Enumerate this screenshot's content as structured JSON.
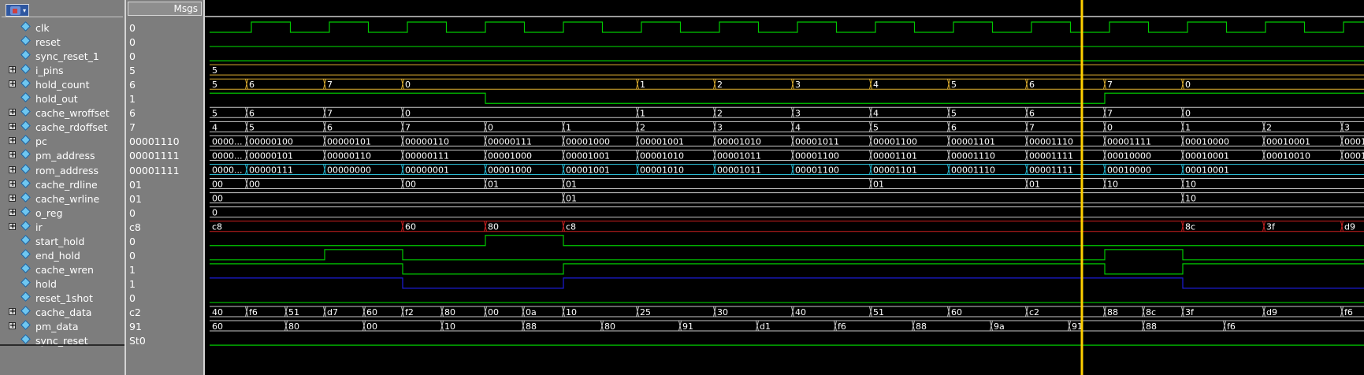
{
  "toolbar": {
    "icon": "wave-tool-icon",
    "dropdown": "▾"
  },
  "values_header": "Msgs",
  "colors": {
    "bit": "#00c800",
    "bus": "#c8c8c8",
    "yellow": "#e0b030",
    "cyan": "#2ab8d0",
    "red": "#d02020",
    "blue": "#1c1cd8",
    "cursor": "#ffd000"
  },
  "signals": [
    {
      "name": "clk",
      "value": "0",
      "expandable": false
    },
    {
      "name": "reset",
      "value": "0",
      "expandable": false
    },
    {
      "name": "sync_reset_1",
      "value": "0",
      "expandable": false
    },
    {
      "name": "i_pins",
      "value": "5",
      "expandable": true
    },
    {
      "name": "hold_count",
      "value": "6",
      "expandable": true
    },
    {
      "name": "hold_out",
      "value": "1",
      "expandable": false
    },
    {
      "name": "cache_wroffset",
      "value": "6",
      "expandable": true
    },
    {
      "name": "cache_rdoffset",
      "value": "7",
      "expandable": true
    },
    {
      "name": "pc",
      "value": "00001110",
      "expandable": true
    },
    {
      "name": "pm_address",
      "value": "00001111",
      "expandable": true
    },
    {
      "name": "rom_address",
      "value": "00001111",
      "expandable": true
    },
    {
      "name": "cache_rdline",
      "value": "01",
      "expandable": true
    },
    {
      "name": "cache_wrline",
      "value": "01",
      "expandable": true
    },
    {
      "name": "o_reg",
      "value": "0",
      "expandable": true
    },
    {
      "name": "ir",
      "value": "c8",
      "expandable": true
    },
    {
      "name": "start_hold",
      "value": "0",
      "expandable": false
    },
    {
      "name": "end_hold",
      "value": "0",
      "expandable": false
    },
    {
      "name": "cache_wren",
      "value": "1",
      "expandable": false
    },
    {
      "name": "hold",
      "value": "1",
      "expandable": false
    },
    {
      "name": "reset_1shot",
      "value": "0",
      "expandable": false
    },
    {
      "name": "cache_data",
      "value": "c2",
      "expandable": true
    },
    {
      "name": "pm_data",
      "value": "91",
      "expandable": true
    },
    {
      "name": "sync_reset",
      "value": "St0",
      "expandable": false
    }
  ],
  "waves": {
    "clk": {
      "type": "clock",
      "color": "bit",
      "initial": 0,
      "period": 99,
      "start": 53,
      "high_first": true
    },
    "reset": {
      "type": "level",
      "color": "bit",
      "level": 0
    },
    "sync_reset_1": {
      "type": "level",
      "color": "bit",
      "level": 0
    },
    "i_pins": {
      "type": "bus",
      "color": "yellow",
      "segments": [
        [
          "5",
          0
        ]
      ]
    },
    "hold_count": {
      "type": "bus",
      "color": "yellow",
      "segments": [
        [
          "5",
          0
        ],
        [
          "6",
          47
        ],
        [
          "7",
          146
        ],
        [
          "0",
          245
        ],
        [
          "1",
          543
        ],
        [
          "2",
          641
        ],
        [
          "3",
          740
        ],
        [
          "4",
          839
        ],
        [
          "5",
          938
        ],
        [
          "6",
          1037
        ],
        [
          "7",
          1136
        ],
        [
          "0",
          1235
        ]
      ]
    },
    "hold_out": {
      "type": "edges",
      "color": "bit",
      "initial": 1,
      "edges": [
        [
          0,
          1
        ],
        [
          350,
          0
        ],
        [
          1136,
          1
        ]
      ]
    },
    "cache_wroffset": {
      "type": "bus",
      "color": "bus",
      "segments": [
        [
          "5",
          0
        ],
        [
          "6",
          47
        ],
        [
          "7",
          146
        ],
        [
          "0",
          245
        ],
        [
          "1",
          543
        ],
        [
          "2",
          641
        ],
        [
          "3",
          740
        ],
        [
          "4",
          839
        ],
        [
          "5",
          938
        ],
        [
          "6",
          1037
        ],
        [
          "7",
          1136
        ],
        [
          "0",
          1235
        ]
      ]
    },
    "cache_rdoffset": {
      "type": "bus",
      "color": "bus",
      "segments": [
        [
          "4",
          0
        ],
        [
          "5",
          47
        ],
        [
          "6",
          146
        ],
        [
          "7",
          245
        ],
        [
          "0",
          350
        ],
        [
          "1",
          449
        ],
        [
          "2",
          543
        ],
        [
          "3",
          641
        ],
        [
          "4",
          740
        ],
        [
          "5",
          839
        ],
        [
          "6",
          938
        ],
        [
          "7",
          1037
        ],
        [
          "0",
          1136
        ],
        [
          "1",
          1235
        ],
        [
          "2",
          1338
        ],
        [
          "3",
          1437
        ]
      ]
    },
    "pc": {
      "type": "bus",
      "color": "bus",
      "segments": [
        [
          "0000...",
          0
        ],
        [
          "00000100",
          47
        ],
        [
          "00000101",
          146
        ],
        [
          "00000110",
          245
        ],
        [
          "00000111",
          350
        ],
        [
          "00001000",
          449
        ],
        [
          "00001001",
          543
        ],
        [
          "00001010",
          641
        ],
        [
          "00001011",
          740
        ],
        [
          "00001100",
          839
        ],
        [
          "00001101",
          938
        ],
        [
          "00001110",
          1037
        ],
        [
          "00001111",
          1136
        ],
        [
          "00010000",
          1235
        ],
        [
          "00010001",
          1338
        ],
        [
          "0001",
          1437
        ]
      ]
    },
    "pm_address": {
      "type": "bus",
      "color": "bus",
      "segments": [
        [
          "0000...",
          0
        ],
        [
          "00000101",
          47
        ],
        [
          "00000110",
          146
        ],
        [
          "00000111",
          245
        ],
        [
          "00001000",
          350
        ],
        [
          "00001001",
          449
        ],
        [
          "00001010",
          543
        ],
        [
          "00001011",
          641
        ],
        [
          "00001100",
          740
        ],
        [
          "00001101",
          839
        ],
        [
          "00001110",
          938
        ],
        [
          "00001111",
          1037
        ],
        [
          "00010000",
          1136
        ],
        [
          "00010001",
          1235
        ],
        [
          "00010010",
          1338
        ],
        [
          "0001",
          1437
        ]
      ]
    },
    "rom_address": {
      "type": "bus",
      "color": "cyan",
      "segments": [
        [
          "0000...",
          0
        ],
        [
          "00000111",
          47
        ],
        [
          "00000000",
          146
        ],
        [
          "00000001",
          245
        ],
        [
          "00001000",
          350
        ],
        [
          "00001001",
          449
        ],
        [
          "00001010",
          543
        ],
        [
          "00001011",
          641
        ],
        [
          "00001100",
          740
        ],
        [
          "00001101",
          839
        ],
        [
          "00001110",
          938
        ],
        [
          "00001111",
          1037
        ],
        [
          "00010000",
          1136
        ],
        [
          "00010001",
          1235
        ]
      ]
    },
    "cache_rdline": {
      "type": "bus",
      "color": "bus",
      "segments": [
        [
          "00",
          0
        ],
        [
          "00",
          47
        ],
        [
          "00",
          245
        ],
        [
          "01",
          350
        ],
        [
          "01",
          449
        ],
        [
          "01",
          839
        ],
        [
          "01",
          1037
        ],
        [
          "10",
          1136
        ],
        [
          "10",
          1235
        ]
      ]
    },
    "cache_wrline": {
      "type": "bus",
      "color": "bus",
      "segments": [
        [
          "00",
          0
        ],
        [
          "01",
          449
        ],
        [
          "10",
          1235
        ]
      ]
    },
    "o_reg": {
      "type": "bus",
      "color": "bus",
      "segments": [
        [
          "0",
          0
        ]
      ]
    },
    "ir": {
      "type": "bus",
      "color": "red",
      "segments": [
        [
          "c8",
          0
        ],
        [
          "60",
          245
        ],
        [
          "80",
          350
        ],
        [
          "c8",
          449
        ],
        [
          "8c",
          1235
        ],
        [
          "3f",
          1338
        ],
        [
          "d9",
          1437
        ]
      ]
    },
    "start_hold": {
      "type": "edges",
      "color": "bit",
      "initial": 0,
      "edges": [
        [
          0,
          0
        ],
        [
          350,
          1
        ],
        [
          449,
          0
        ]
      ]
    },
    "end_hold": {
      "type": "edges",
      "color": "bit",
      "initial": 0,
      "edges": [
        [
          0,
          0
        ],
        [
          146,
          1
        ],
        [
          245,
          0
        ],
        [
          1136,
          1
        ],
        [
          1235,
          0
        ]
      ]
    },
    "cache_wren": {
      "type": "edges",
      "color": "bit",
      "initial": 1,
      "edges": [
        [
          0,
          1
        ],
        [
          245,
          0
        ],
        [
          449,
          1
        ],
        [
          1136,
          0
        ],
        [
          1235,
          1
        ]
      ]
    },
    "hold": {
      "type": "edges",
      "color": "blue",
      "initial": 1,
      "edges": [
        [
          0,
          1
        ],
        [
          245,
          0
        ],
        [
          449,
          1
        ],
        [
          1235,
          0
        ]
      ]
    },
    "reset_1shot": {
      "type": "level",
      "color": "bit",
      "level": 0
    },
    "cache_data": {
      "type": "bus",
      "color": "bus",
      "segments": [
        [
          "40",
          0
        ],
        [
          "f6",
          47
        ],
        [
          "51",
          97
        ],
        [
          "d7",
          146
        ],
        [
          "60",
          196
        ],
        [
          "f2",
          245
        ],
        [
          "80",
          295
        ],
        [
          "00",
          350
        ],
        [
          "0a",
          398
        ],
        [
          "10",
          449
        ],
        [
          "25",
          543
        ],
        [
          "30",
          641
        ],
        [
          "40",
          740
        ],
        [
          "51",
          839
        ],
        [
          "60",
          938
        ],
        [
          "c2",
          1037
        ],
        [
          "88",
          1136
        ],
        [
          "8c",
          1185
        ],
        [
          "3f",
          1235
        ],
        [
          "d9",
          1338
        ],
        [
          "f6",
          1437
        ]
      ]
    },
    "pm_data": {
      "type": "bus",
      "color": "bus",
      "segments": [
        [
          "60",
          0
        ],
        [
          "80",
          97
        ],
        [
          "00",
          196
        ],
        [
          "10",
          295
        ],
        [
          "88",
          398
        ],
        [
          "80",
          498
        ],
        [
          "91",
          597
        ],
        [
          "d1",
          695
        ],
        [
          "f6",
          794
        ],
        [
          "88",
          893
        ],
        [
          "9a",
          992
        ],
        [
          "91",
          1091
        ],
        [
          "88",
          1185
        ],
        [
          "f6",
          1288
        ]
      ]
    },
    "sync_reset": {
      "type": "level",
      "color": "bit",
      "level": 0
    }
  },
  "cursor": {
    "time": 1107
  }
}
